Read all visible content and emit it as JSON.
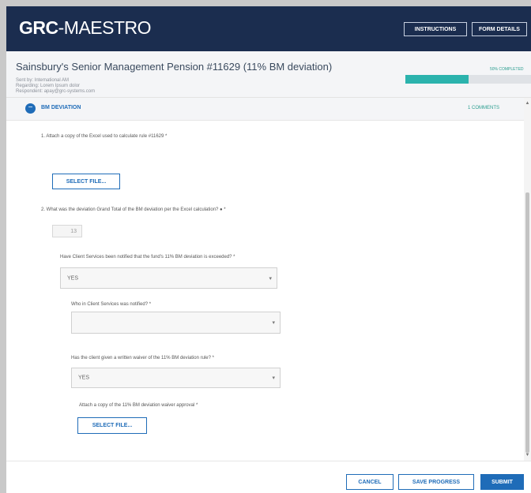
{
  "header": {
    "logo_bold": "GRC",
    "logo_rest": "-MAESTRO",
    "instructions_label": "INSTRUCTIONS",
    "form_details_label": "FORM DETAILS"
  },
  "form": {
    "title": "Sainsbury's Senior Management Pension #11629 (11% BM deviation)",
    "sent_by": "Sent by: International AM",
    "regarding": "Regarding: Lorem Ipsum dolor",
    "respondent": "Respondent: apay@grc-systems.com",
    "progress_label": "50% COMPLETED",
    "progress_fraction": 0.5
  },
  "section": {
    "icon": "minus-icon",
    "title": "BM DEVIATION",
    "comments": "1 COMMENTS"
  },
  "questions": {
    "q1": "1.  Attach a copy of the Excel used to calculate rule #11629 *",
    "q1_button": "SELECT FILE...",
    "q2": "2.  What was the deviation Grand Total of the BM deviation per the Excel calculation? ● *",
    "q2_value": "13",
    "q3": "Have Client Services been notified that the fund's 11% BM deviation is exceeded? *",
    "q3_value": "YES",
    "q4": "Who in Client Services was notified? *",
    "q4_value": "",
    "q5": "Has the client given a written waiver of the 11% BM deviation rule? *",
    "q5_value": "YES",
    "q6": "Attach a copy of the 11% BM deviation waiver approval *",
    "q6_button": "SELECT FILE..."
  },
  "footer": {
    "cancel": "CANCEL",
    "save": "SAVE PROGRESS",
    "submit": "SUBMIT"
  },
  "colors": {
    "header_bg": "#1b2d4f",
    "accent": "#1f6cb8",
    "progress": "#2bb3ad"
  }
}
